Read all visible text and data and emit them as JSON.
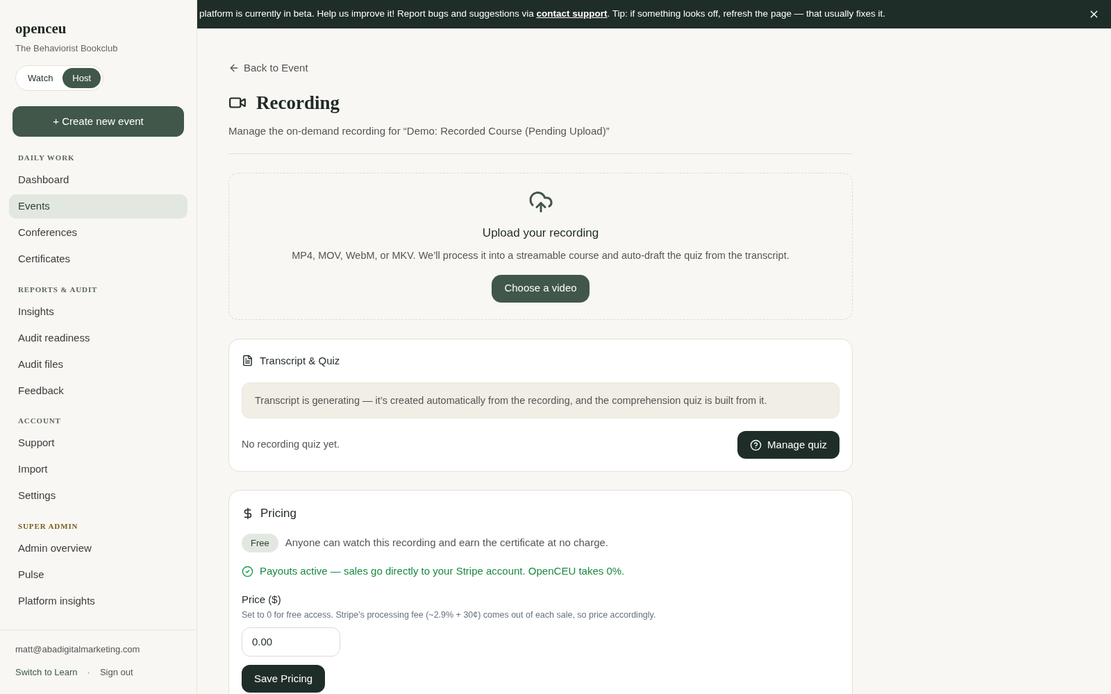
{
  "sidebar": {
    "logo": "openceu",
    "org": "The Behaviorist Bookclub",
    "mode_toggle": [
      {
        "label": "Watch",
        "selected": false
      },
      {
        "label": "Host",
        "selected": true
      }
    ],
    "create_button": "+ Create new event",
    "sections": [
      {
        "heading": "DAILY WORK",
        "color": "#5f6660",
        "items": [
          {
            "label": "Dashboard",
            "selected": false
          },
          {
            "label": "Events",
            "selected": true
          },
          {
            "label": "Conferences",
            "selected": false
          },
          {
            "label": "Certificates",
            "selected": false
          }
        ]
      },
      {
        "heading": "REPORTS & AUDIT",
        "color": "#5f6660",
        "items": [
          {
            "label": "Insights",
            "selected": false
          },
          {
            "label": "Audit readiness",
            "selected": false
          },
          {
            "label": "Audit files",
            "selected": false
          },
          {
            "label": "Feedback",
            "selected": false
          }
        ]
      },
      {
        "heading": "ACCOUNT",
        "color": "#5f6660",
        "items": [
          {
            "label": "Support",
            "selected": false
          },
          {
            "label": "Import",
            "selected": false
          },
          {
            "label": "Settings",
            "selected": false
          }
        ]
      },
      {
        "heading": "SUPER ADMIN",
        "color": "#7a5a1e",
        "items": [
          {
            "label": "Admin overview",
            "selected": false
          },
          {
            "label": "Pulse",
            "selected": false
          },
          {
            "label": "Platform insights",
            "selected": false
          }
        ]
      }
    ],
    "email": "matt@abadigitalmarketing.com",
    "switch_link": "Switch to Learn",
    "separator": "·",
    "sign_out": "Sign out"
  },
  "banner": {
    "text_before": "platform is currently in beta. Help us improve it! Report bugs and suggestions via ",
    "link": "contact support",
    "text_after": ". Tip: if something looks off, refresh the page — that usually fixes it."
  },
  "back_link": "Back to Event",
  "title": "Recording",
  "subtitle": "Manage the on-demand recording for “Demo: Recorded Course (Pending Upload)”",
  "upload": {
    "title": "Upload your recording",
    "description": "MP4, MOV, WebM, or MKV. We’ll process it into a streamable course and auto-draft the quiz from the transcript.",
    "button": "Choose a video"
  },
  "transcript": {
    "title": "Transcript & Quiz",
    "notice": "Transcript is generating — it’s created automatically from the recording, and the comprehension quiz is built from it.",
    "status": "No recording quiz yet.",
    "button": "Manage quiz"
  },
  "pricing": {
    "title": "Pricing",
    "badge": "Free",
    "badge_text": "Anyone can watch this recording and earn the certificate at no charge.",
    "payouts": "Payouts active — sales go directly to your Stripe account. OpenCEU takes 0%.",
    "price_label": "Price ($)",
    "price_hint": "Set to 0 for free access. Stripe’s processing fee (~2.9% + 30¢) comes out of each sale, so price accordingly.",
    "price_value": "0.00",
    "save_button": "Save Pricing"
  }
}
